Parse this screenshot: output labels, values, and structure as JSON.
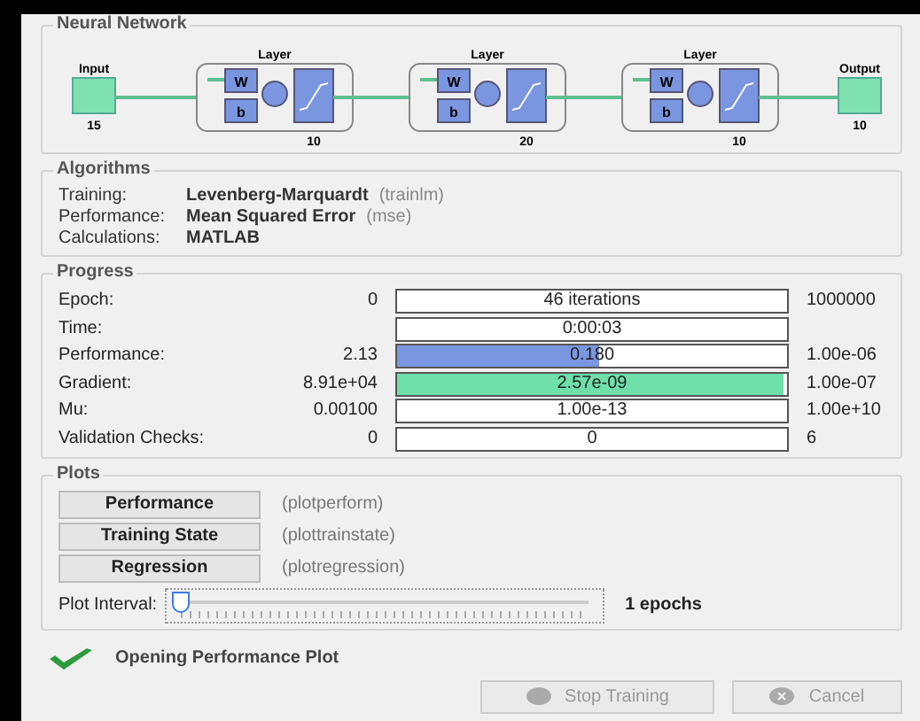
{
  "network": {
    "title": "Neural Network",
    "input": {
      "label": "Input",
      "size": "15"
    },
    "layers": [
      {
        "label": "Layer",
        "weight": "W",
        "bias": "b",
        "size": "10"
      },
      {
        "label": "Layer",
        "weight": "W",
        "bias": "b",
        "size": "20"
      },
      {
        "label": "Layer",
        "weight": "W",
        "bias": "b",
        "size": "10"
      }
    ],
    "output": {
      "label": "Output",
      "size": "10"
    }
  },
  "algorithms": {
    "title": "Algorithms",
    "rows": [
      {
        "label": "Training:",
        "value": "Levenberg-Marquardt",
        "function": "(trainlm)"
      },
      {
        "label": "Performance:",
        "value": "Mean Squared Error",
        "function": "(mse)"
      },
      {
        "label": "Calculations:",
        "value": "MATLAB"
      }
    ]
  },
  "progress": {
    "title": "Progress",
    "rows": [
      {
        "label": "Epoch:",
        "start": "0",
        "reading": "46 iterations",
        "end": "1000000"
      },
      {
        "label": "Time:",
        "reading": "0:00:03"
      },
      {
        "label": "Performance:",
        "start": "2.13",
        "reading": "0.180",
        "end": "1.00e-06",
        "level": 0.52,
        "color": "#7b96e0"
      },
      {
        "label": "Gradient:",
        "start": "8.91e+04",
        "reading": "2.57e-09",
        "end": "1.00e-07",
        "level": 0.99,
        "color": "#6fe0aa"
      },
      {
        "label": "Mu:",
        "start": "0.00100",
        "reading": "1.00e-13",
        "end": "1.00e+10"
      },
      {
        "label": "Validation Checks:",
        "start": "0",
        "reading": "0",
        "end": "6"
      }
    ]
  },
  "plots": {
    "title": "Plots",
    "buttons": [
      {
        "label": "Performance",
        "function": "(plotperform)"
      },
      {
        "label": "Training State",
        "function": "(plottrainstate)"
      },
      {
        "label": "Regression",
        "function": "(plotregression)"
      }
    ],
    "interval": {
      "label": "Plot Interval:",
      "level": 0,
      "reading": "1 epochs"
    }
  },
  "status": {
    "message": "Opening Performance Plot"
  },
  "buttons": [
    {
      "label": "Stop Training",
      "kind": "stop",
      "disabled": true
    },
    {
      "label": "Cancel",
      "kind": "cancel",
      "disabled": true
    }
  ]
}
